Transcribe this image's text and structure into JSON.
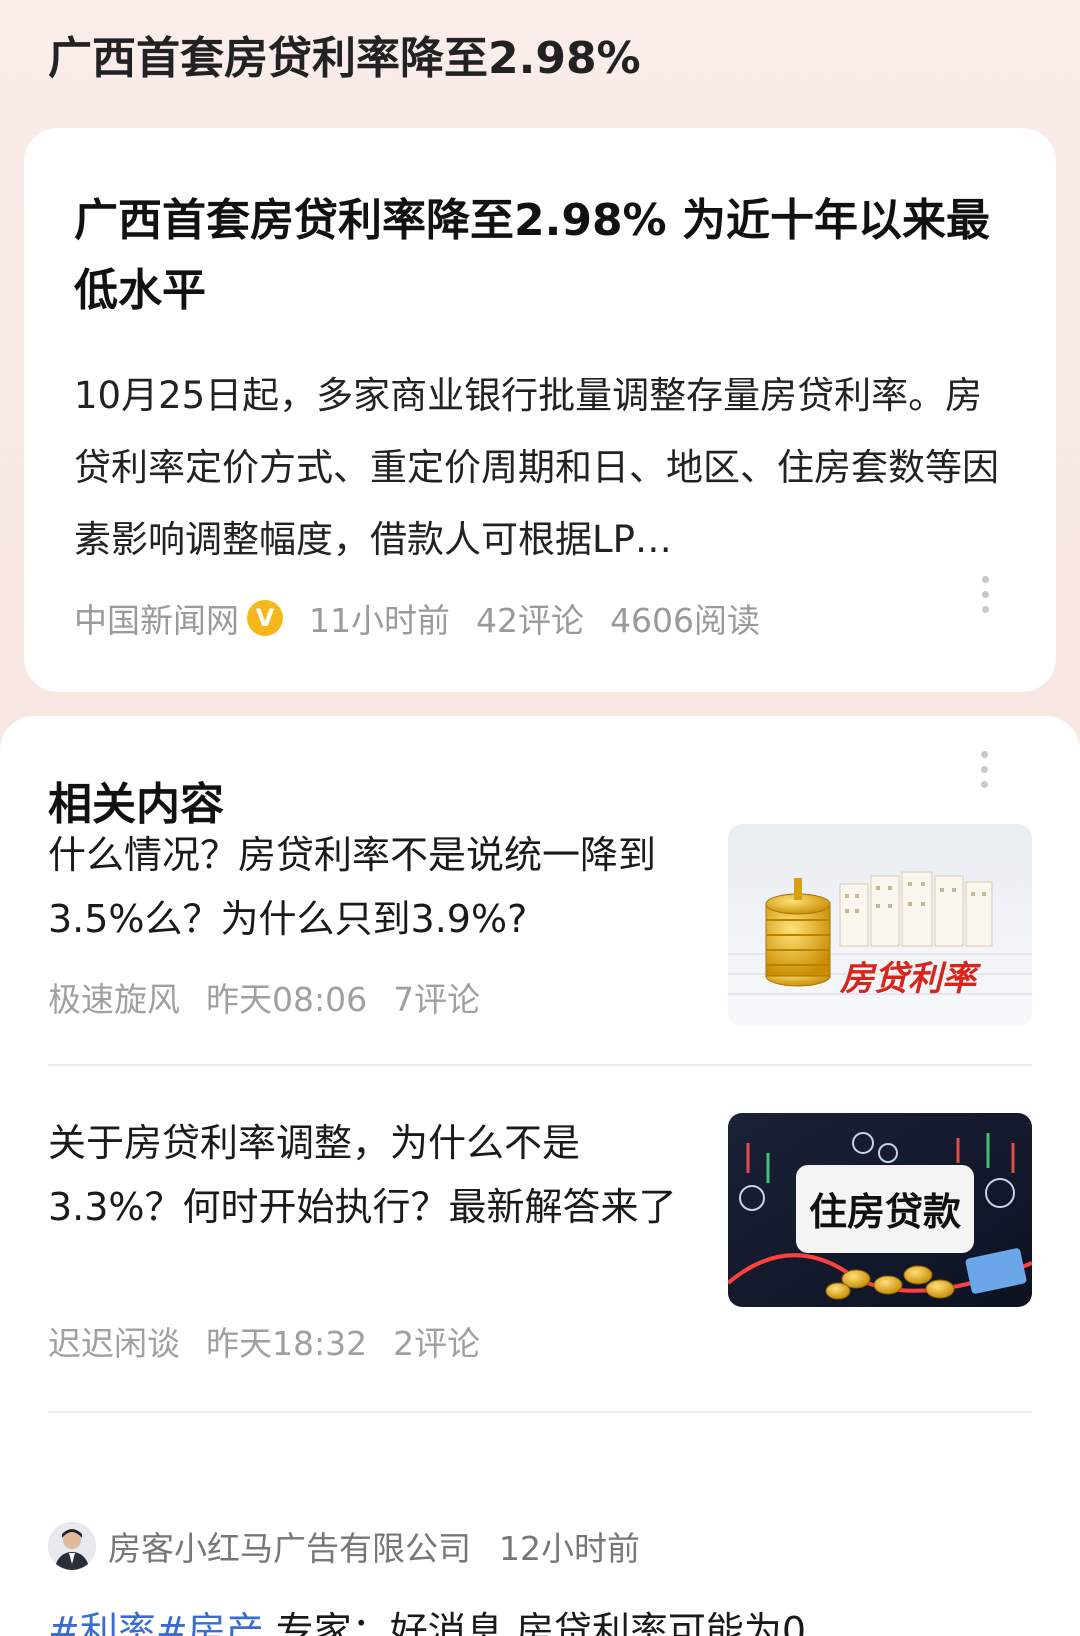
{
  "page_title": "广西首套房贷利率降至2.98%",
  "main_article": {
    "headline": "广西首套房贷利率降至2.98% 为近十年以来最低水平",
    "summary": "10月25日起，多家商业银行批量调整存量房贷利率。房贷利率定价方式、重定价周期和日、地区、住房套数等因素影响调整幅度，借款人可根据LP…",
    "source": "中国新闻网",
    "verified_badge": "V",
    "time": "11小时前",
    "comments": "42评论",
    "reads": "4606阅读",
    "more_icon": "more-vertical-icon"
  },
  "related": {
    "title": "相关内容",
    "items": [
      {
        "title": "什么情况？房贷利率不是说统一降到3.5%么？为什么只到3.9%?",
        "author": "极速旋风",
        "time": "昨天08:06",
        "comments": "7评论",
        "thumb_text": "房贷利率"
      },
      {
        "title": "关于房贷利率调整，为什么不是3.3%？何时开始执行？最新解答来了",
        "author": "迟迟闲谈",
        "time": "昨天18:32",
        "comments": "2评论",
        "thumb_text": "住房贷款"
      }
    ]
  },
  "ad_post": {
    "author": "房客小红马广告有限公司",
    "time": "12小时前",
    "tags": "#利率#房产",
    "text": "专家：好消息,房贷利率可能为0"
  },
  "colors": {
    "accent_blue": "#3a6bd1",
    "badge_gold": "#f5b71c",
    "muted_gray": "#9a9a9a"
  }
}
